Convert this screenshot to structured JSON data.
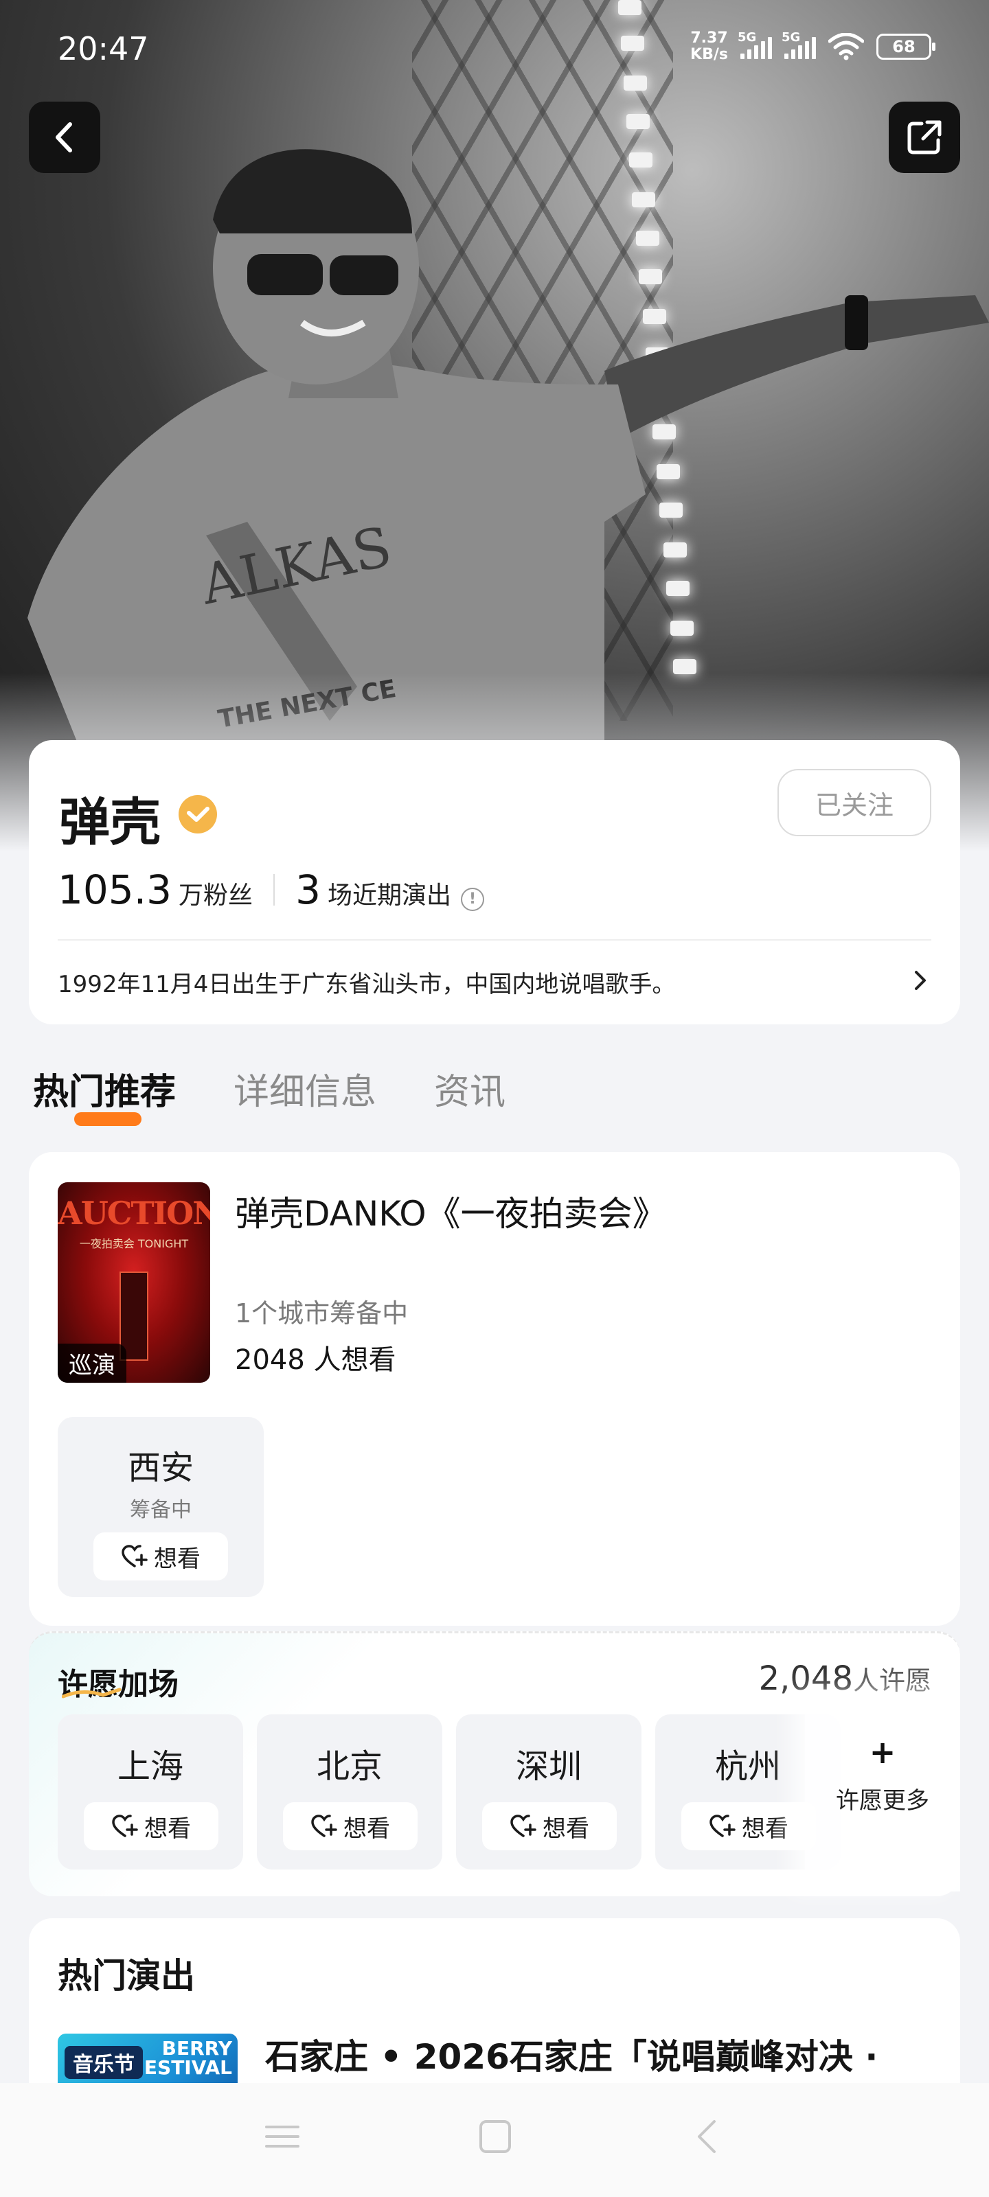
{
  "status_bar": {
    "time": "20:47",
    "net_speed_top": "7.37",
    "net_speed_bottom": "KB/s",
    "sig1": "5G",
    "sig2": "5G",
    "battery": "68"
  },
  "artist": {
    "name": "弹壳",
    "follow_label": "已关注",
    "fans_num": "105.3",
    "fans_unit": "万粉丝",
    "shows_num": "3",
    "shows_unit": "场近期演出",
    "info_mark": "!",
    "bio": "1992年11月4日出生于广东省汕头市，中国内地说唱歌手。"
  },
  "tabs": [
    {
      "label": "热门推荐"
    },
    {
      "label": "详细信息"
    },
    {
      "label": "资讯"
    }
  ],
  "tour": {
    "poster_title": "AUCTION",
    "poster_sub": "一夜拍卖会 TONIGHT",
    "badge": "巡演",
    "title": "弹壳DANKO《一夜拍卖会》",
    "status": "1个城市筹备中",
    "want_count": "2048 人想看",
    "city": {
      "name": "西安",
      "status": "筹备中",
      "want_label": "想看"
    }
  },
  "wish": {
    "title": "许愿加场",
    "count": "2,048",
    "count_unit": "人许愿",
    "cities": [
      {
        "name": "上海",
        "want_label": "想看"
      },
      {
        "name": "北京",
        "want_label": "想看"
      },
      {
        "name": "深圳",
        "want_label": "想看"
      },
      {
        "name": "杭州",
        "want_label": "想看"
      }
    ],
    "more_plus": "+",
    "more_label": "许愿更多"
  },
  "shows": {
    "heading": "热门演出",
    "thumb_tag": "音乐节",
    "thumb_text": "BERRY FESTIVAL",
    "title": "石家庄 • 2026石家庄「说唱巅峰对决 ·"
  },
  "colors": {
    "accent": "#ff7b1a",
    "verified": "#f5b64a",
    "background": "#f3f4f7"
  }
}
